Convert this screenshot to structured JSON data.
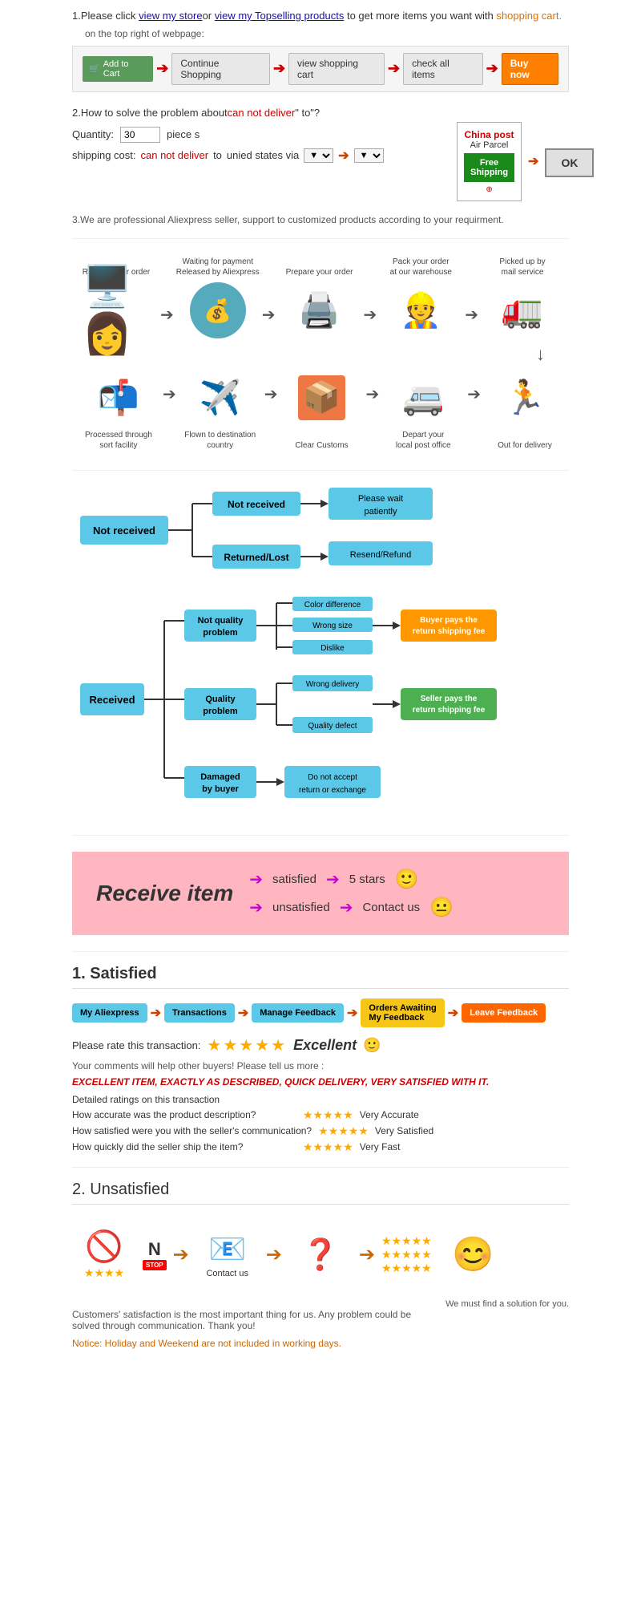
{
  "step1": {
    "text_before": "1.Please click ",
    "link1": "view my store",
    "text_mid1": "or ",
    "link2": "view my Topselling products",
    "text_after": " to get more items you want with",
    "link_shopping": "shopping cart.",
    "top_right": "on the top right of webpage:",
    "btn_add": "Add to Cart",
    "btn_continue": "Continue Shopping",
    "btn_view": "view shopping cart",
    "btn_check": "check all items",
    "btn_buy": "Buy now"
  },
  "step2": {
    "header": "2.How to solve the problem about",
    "cannot": "can not deliver",
    "to_text": " to",
    "qty_label": "Quantity:",
    "qty_value": "30",
    "pieces": "piece s",
    "shipping_label": "shipping cost:",
    "cannot2": "can not deliver",
    "to_text2": " to ",
    "via_text": "unied states via",
    "china_post_title": "China post",
    "air_parcel": "Air Parcel",
    "free_shipping": "Free Shipping",
    "ok_btn": "OK"
  },
  "step3": {
    "text": "3.We are professional Aliexpress seller, support to customized products according to your requirment."
  },
  "process": {
    "row1": [
      {
        "label": "Receive your order",
        "icon": "🖥️"
      },
      {
        "label": "Waiting for payment\nReleased by Aliexpress",
        "icon": "💰"
      },
      {
        "label": "Prepare your order",
        "icon": "🖨️"
      },
      {
        "label": "Pack your order\nat our warehouse",
        "icon": "👷"
      },
      {
        "label": "Picked up by\nmail service",
        "icon": "🚛"
      }
    ],
    "row2": [
      {
        "label": "Out for delivery",
        "icon": "🏃"
      },
      {
        "label": "Depart your\nlocal post office",
        "icon": "🚐"
      },
      {
        "label": "Clear Customs",
        "icon": "📦"
      },
      {
        "label": "Flown to destination\ncountry",
        "icon": "✈️"
      },
      {
        "label": "Processed through\nsort facility",
        "icon": "📬"
      }
    ]
  },
  "not_received": {
    "main": "Not received",
    "branch1": "Not received",
    "result1": "Please wait\npatiently",
    "branch2": "Returned/Lost",
    "result2": "Resend/Refund"
  },
  "received": {
    "main": "Received",
    "branch1_label": "Not quality\nproblem",
    "branch1_subs": [
      "Color difference",
      "Wrong size",
      "Dislike"
    ],
    "branch1_result": "Buyer pays the\nreturn shipping fee",
    "branch2_label": "Quality\nproblem",
    "branch2_subs": [
      "Wrong delivery",
      "Quality defect"
    ],
    "branch2_result": "Seller pays the\nreturn shipping fee",
    "branch3_label": "Damaged\nby buyer",
    "branch3_result": "Do not accept\nreturn or exchange"
  },
  "receive_banner": {
    "title": "Receive item",
    "satisfied": "satisfied",
    "unsatisfied": "unsatisfied",
    "five_stars": "5 stars",
    "contact": "Contact us",
    "emoji1": "🙂",
    "emoji2": "😐"
  },
  "satisfied": {
    "title_num": "1.",
    "title_label": "Satisfied",
    "steps": [
      "My Aliexpress",
      "Transactions",
      "Manage Feedback",
      "Orders Awaiting\nMy Feedback",
      "Leave Feedback"
    ],
    "rate_label": "Please rate this transaction:",
    "excellent": "Excellent",
    "emoji": "🙂",
    "comments": "Your comments will help other buyers! Please tell us more :",
    "excellent_item": "EXCELLENT ITEM, EXACTLY AS DESCRIBED, QUICK DELIVERY, VERY SATISFIED WITH IT.",
    "detailed": "Detailed ratings on this transaction",
    "rating1_label": "How accurate was the product description?",
    "rating1_stars": "★★★★★",
    "rating1_value": "Very Accurate",
    "rating2_label": "How satisfied were you with the seller's communication?",
    "rating2_stars": "★★★★★",
    "rating2_value": "Very Satisfied",
    "rating3_label": "How quickly did the seller ship the item?",
    "rating3_stars": "★★★★★",
    "rating3_value": "Very Fast"
  },
  "unsatisfied": {
    "title_num": "2.",
    "title_label": "Unsatisfied",
    "contact_label": "Contact us",
    "solution_label": "We must find\na solution for\nyou.",
    "main_note": "Customers' satisfaction is the most important thing for us. Any problem could be solved through communication. Thank you!",
    "notice": "Notice: Holiday and Weekend are not included in working days."
  }
}
